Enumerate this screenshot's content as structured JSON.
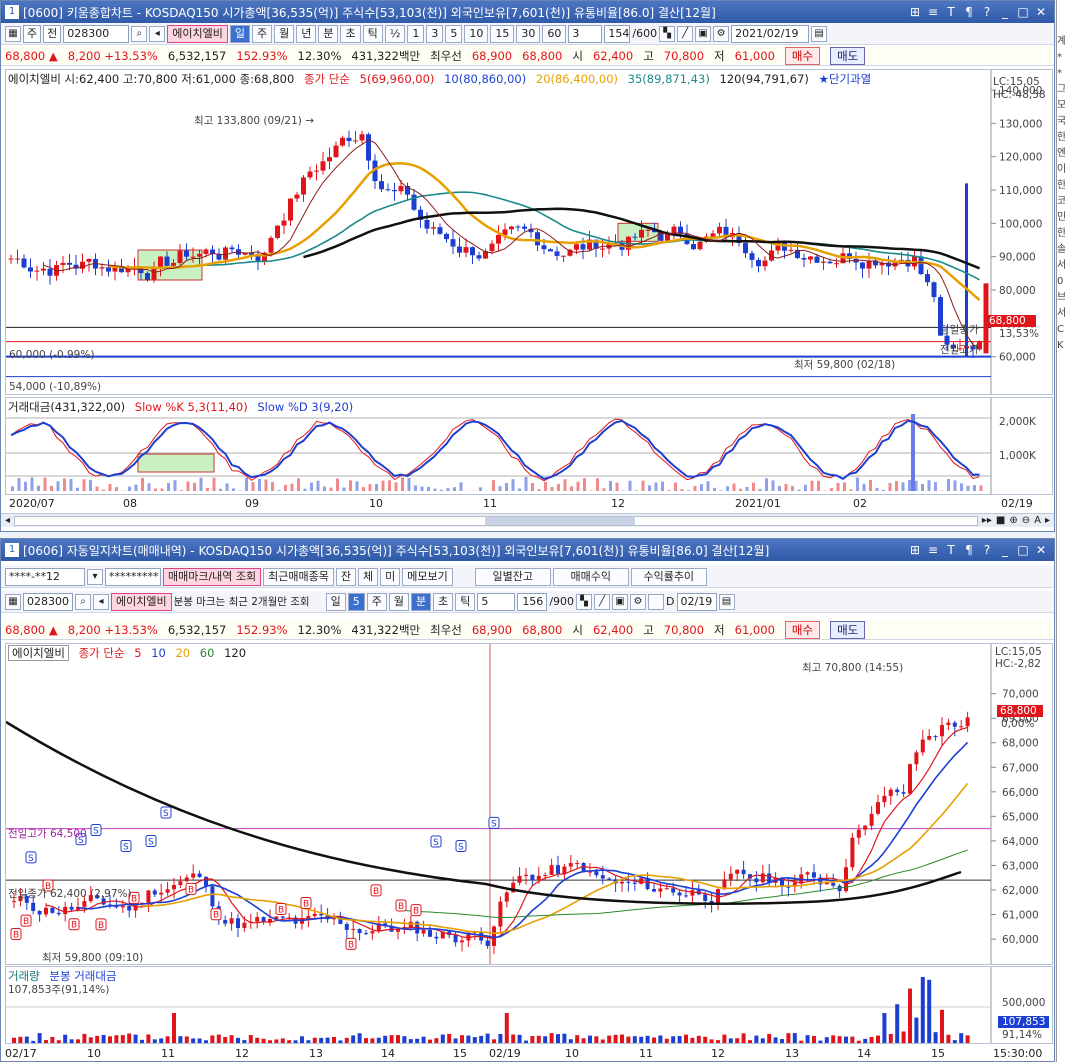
{
  "w1": {
    "title": "[0600] 키움종합차트 - KOSDAQ150 시가총액[36,535(억)] 주식수[53,103(천)] 외국인보유[7,601(천)] 유통비율[86.0] 결산[12월]",
    "toolbar": {
      "type": "주",
      "sub": "전",
      "code": "028300",
      "name": "에이치엘비",
      "periods": [
        "일",
        "주",
        "월",
        "년",
        "분",
        "초",
        "틱"
      ],
      "sel": "일",
      "half": "½",
      "nums": [
        "1",
        "3",
        "5",
        "10",
        "15",
        "30",
        "60"
      ],
      "ticks": "3",
      "count": "154",
      "total": "/600",
      "date": "2021/02/19"
    },
    "quote": {
      "price": "68,800 ▲",
      "chg": "8,200 +13.53%",
      "vol": "6,532,157",
      "ratio": "152.93%",
      "turn": "12.30%",
      "amt": "431,322백만",
      "label": "최우선",
      "bid": "68,900",
      "ask": "68,800",
      "open_l": "시",
      "open": "62,400",
      "high_l": "고",
      "high": "70,800",
      "low_l": "저",
      "low": "61,000",
      "buy": "매수",
      "sell": "매도"
    },
    "legend": {
      "stock": "에이치엘비 시:62,400 고:70,800 저:61,000 종:68,800",
      "ma": "종가 단순",
      "ma5": "5(69,960,00)",
      "ma10": "10(80,860,00)",
      "ma20": "20(86,400,00)",
      "ma35": "35(89,871,43)",
      "ma120": "120(94,791,67)",
      "ovr": "★단기과열"
    },
    "labels": {
      "high": "최고 133,800 (09/21) →",
      "low": "최저 59,800 (02/18)",
      "l60": "60,000 (-0.99%)",
      "l54": "54,000 (-10,89%)",
      "today": "당일종가",
      "prev": "전일고가",
      "lc": "LC:15,05",
      "hc": "HC:-48,58",
      "cur": "68,800",
      "pct": "13,53%"
    },
    "yaxis": [
      "140,000",
      "130,000",
      "120,000",
      "110,000",
      "100,000",
      "90,000",
      "80,000",
      "70,000",
      "60,000"
    ],
    "sub": {
      "amt": "거래대금(431,322,00)",
      "k": "Slow %K 5,3(11,40)",
      "d": "Slow %D 3(9,20)",
      "y": [
        "2,000K",
        "1,000K"
      ]
    },
    "xaxis": [
      "2020/07",
      "08",
      "09",
      "10",
      "11",
      "12",
      "2021/01",
      "02",
      "02/19"
    ]
  },
  "w2": {
    "title": "[0606] 자동일지차트(매매내역) - KOSDAQ150 시가총액[36,535(억)] 주식수[53,103(천)] 외국인보유[7,601(천)] 유통비율[86.0] 결산[12월]",
    "row1": {
      "acct": "****-**12",
      "pw": "*********",
      "b1": "매매마크/내역 조회",
      "b2": "최근매매종목",
      "b3": "잔",
      "b4": "체",
      "b5": "미",
      "b6": "메모보기",
      "b7": "일별잔고",
      "b8": "매매수익",
      "b9": "수익률추이"
    },
    "row2": {
      "code": "028300",
      "name": "에이치엘비",
      "note": "분봉 마크는 최근 2개월만 조회",
      "periods": [
        "일",
        "5",
        "주",
        "월",
        "분",
        "초",
        "틱"
      ],
      "sel": "분",
      "n": "5",
      "count": "156",
      "total": "/900",
      "d": "D",
      "date": "02/19"
    },
    "quote": {
      "price": "68,800 ▲",
      "chg": "8,200 +13.53%",
      "vol": "6,532,157",
      "ratio": "152.93%",
      "turn": "12.30%",
      "amt": "431,322백만",
      "label": "최우선",
      "bid": "68,900",
      "ask": "68,800",
      "open_l": "시",
      "open": "62,400",
      "high_l": "고",
      "high": "70,800",
      "low_l": "저",
      "low": "61,000",
      "buy": "매수",
      "sell": "매도"
    },
    "legend": {
      "stock": "에이치엘비",
      "ma": "종가 단순",
      "m5": "5",
      "m10": "10",
      "m20": "20",
      "m60": "60",
      "m120": "120"
    },
    "labels": {
      "high": "최고 70,800 (14:55)",
      "low": "최저 59,800 (09:10)",
      "prevhigh": "전일고가 64,500",
      "prevclose": "전일종가 62,400 (2,97%)",
      "lc": "LC:15,05",
      "hc": "HC:-2,82",
      "cur": "68,800",
      "pct": "0,00%"
    },
    "yaxis": [
      "70,000",
      "69,000",
      "68,000",
      "67,000",
      "66,000",
      "65,000",
      "64,000",
      "63,000",
      "62,000",
      "61,000",
      "60,000"
    ],
    "sub": {
      "vol": "거래량",
      "amt": "분봉 거래대금",
      "v": "107,853주(91,14%)",
      "y": "500,000",
      "cur": "107,853",
      "pct": "91,14%"
    },
    "xaxis": [
      "02/17",
      "10",
      "11",
      "12",
      "13",
      "14",
      "15",
      "02/19",
      "10",
      "11",
      "12",
      "13",
      "14",
      "15",
      "15:30:00"
    ]
  },
  "side": [
    "계",
    "*",
    "*",
    "그",
    "모",
    "국",
    "한",
    "엔",
    "이",
    "한",
    "코",
    "민",
    "한",
    "솔",
    "서",
    "0",
    "브",
    "서",
    "C",
    "K"
  ]
}
